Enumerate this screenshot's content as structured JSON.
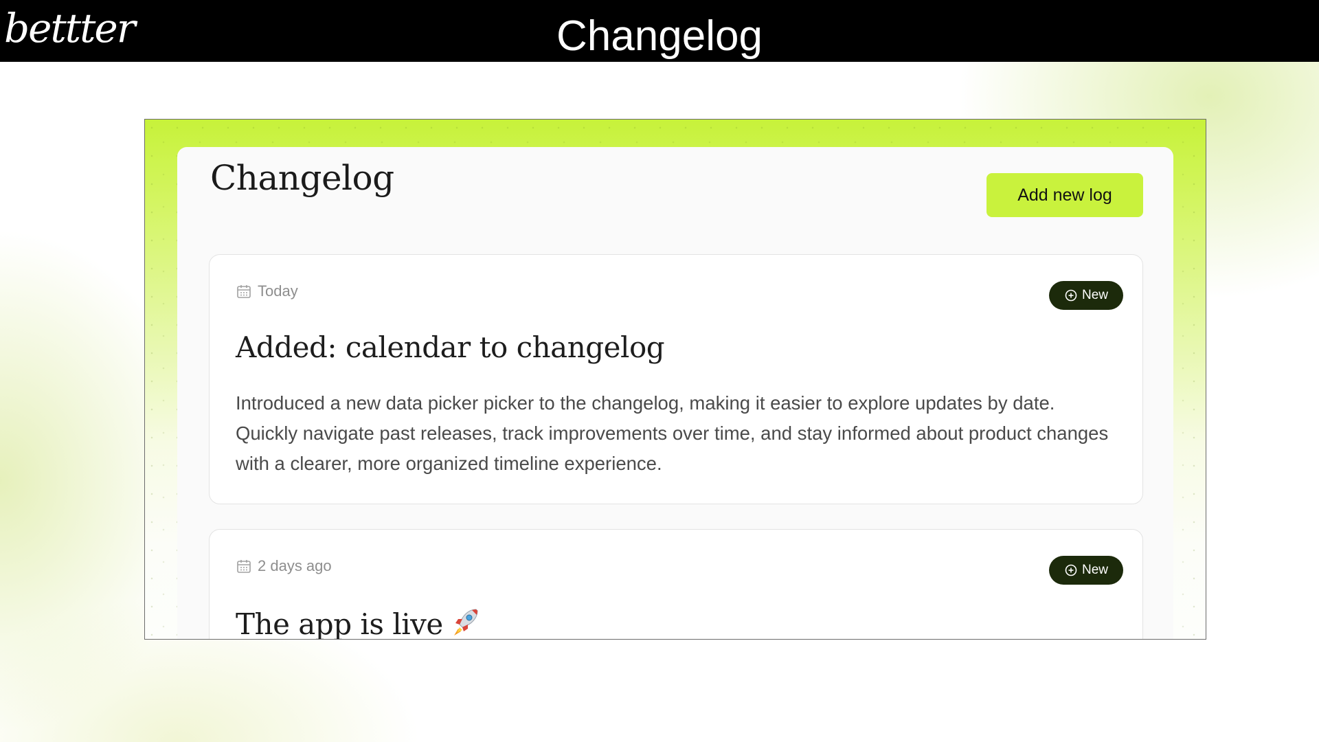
{
  "topbar": {
    "brand": "bettter",
    "title": "Changelog"
  },
  "panel": {
    "title": "Changelog",
    "add_button_label": "Add new log"
  },
  "entries": [
    {
      "date": "Today",
      "badge": "New",
      "title": "Added: calendar to changelog",
      "body": "Introduced a new data picker picker to the changelog, making it easier to explore updates by date. Quickly navigate past releases, track improvements over time, and stay informed about product changes with a clearer, more organized timeline experience.",
      "icon": "calendar-icon"
    },
    {
      "date": "2 days ago",
      "badge": "New",
      "title": "The app is live",
      "title_emoji": "rocket-icon",
      "icon": "calendar-icon"
    }
  ],
  "colors": {
    "accent": "#c9f23d",
    "badge_bg": "#1c2a0b",
    "topbar_bg": "#000000"
  }
}
